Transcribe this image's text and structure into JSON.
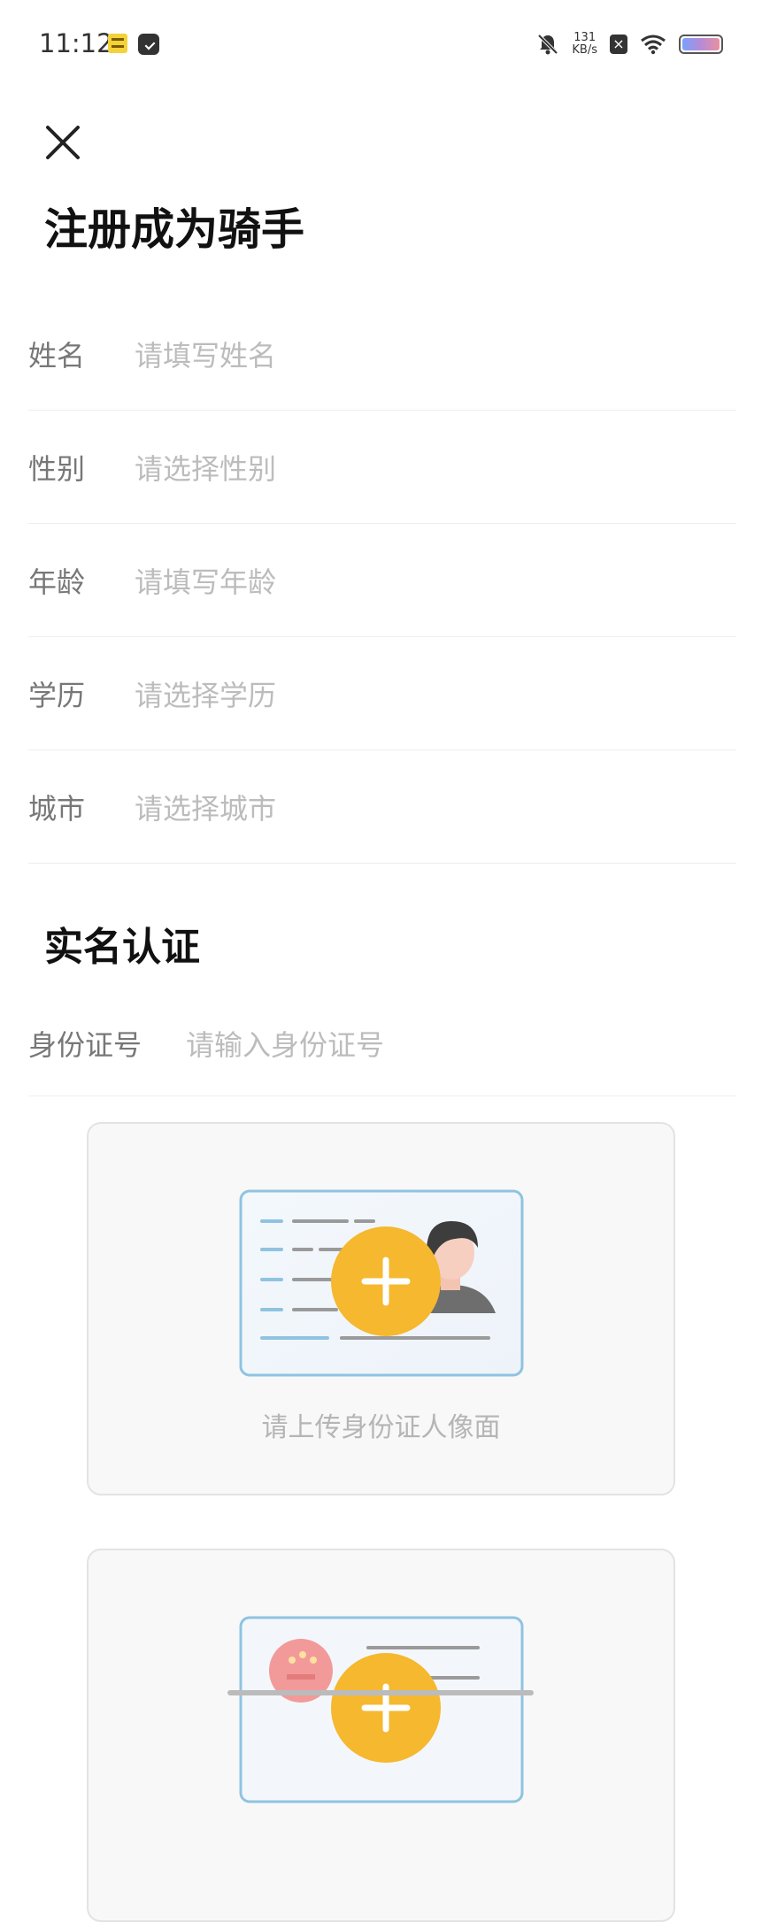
{
  "status_bar": {
    "time": "11:12",
    "net_speed_value": "131",
    "net_speed_unit": "KB/s",
    "icons": [
      "app-notification-icon",
      "message-icon",
      "mute-bell-icon",
      "close-box-icon",
      "wifi-icon",
      "battery-icon"
    ]
  },
  "header": {
    "close_icon": "close-icon",
    "title": "注册成为骑手"
  },
  "form": {
    "fields": [
      {
        "label": "姓名",
        "placeholder": "请填写姓名"
      },
      {
        "label": "性别",
        "placeholder": "请选择性别"
      },
      {
        "label": "年龄",
        "placeholder": "请填写年龄"
      },
      {
        "label": "学历",
        "placeholder": "请选择学历"
      },
      {
        "label": "城市",
        "placeholder": "请选择城市"
      }
    ]
  },
  "verification": {
    "title": "实名认证",
    "id_label": "身份证号",
    "id_placeholder": "请输入身份证号",
    "upload_front": {
      "caption": "请上传身份证人像面",
      "icon": "add-plus-icon"
    },
    "upload_back": {
      "caption": "",
      "icon": "add-plus-icon"
    }
  },
  "colors": {
    "accent_yellow": "#F5B82E",
    "card_border_blue": "#8FC3E0",
    "placeholder_gray": "#BCBCBC"
  }
}
